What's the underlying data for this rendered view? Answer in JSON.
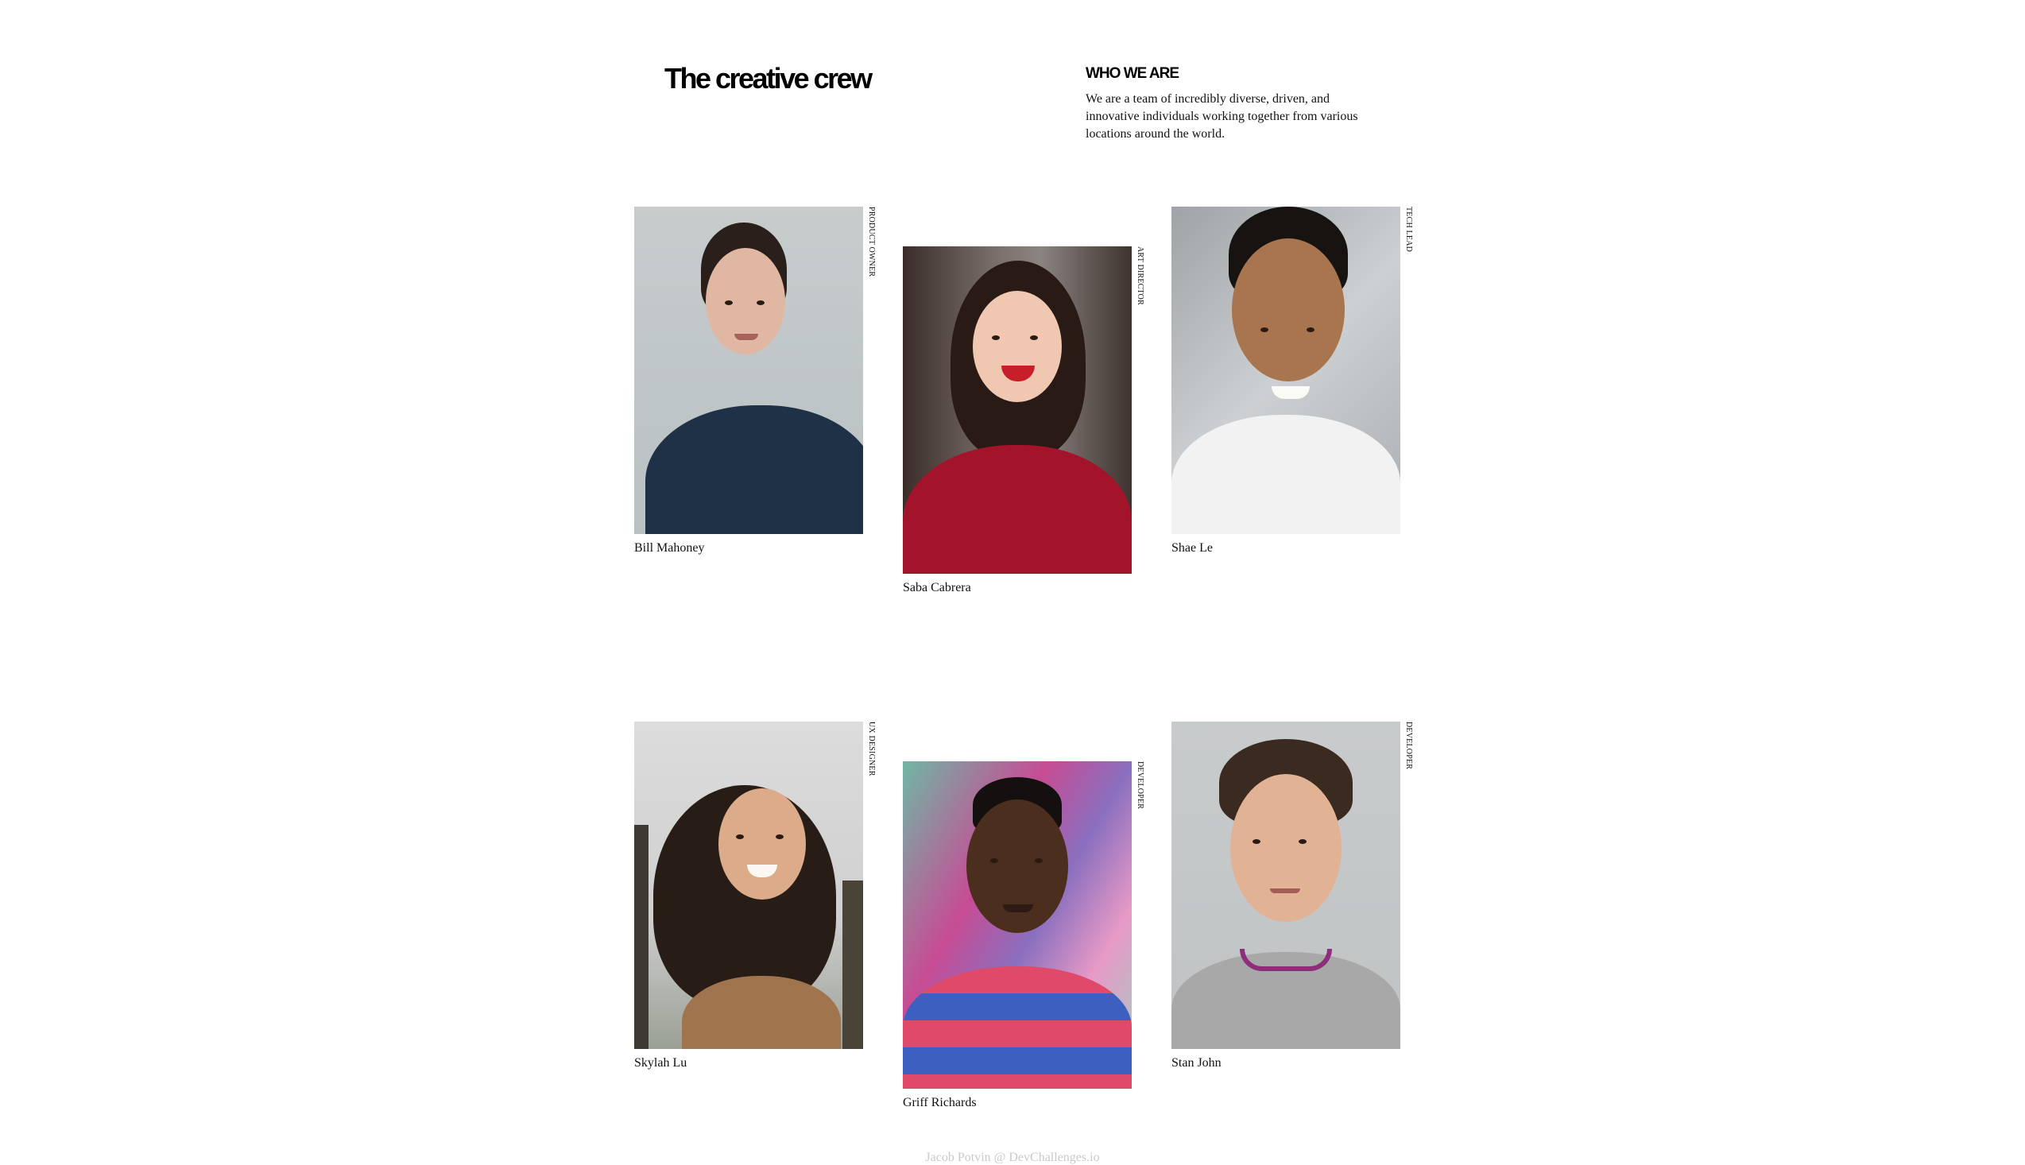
{
  "header": {
    "title": "The creative crew",
    "who_heading": "WHO WE ARE",
    "who_text": "We are a team of incredibly diverse, driven, and innovative individuals working together from various locations around the world."
  },
  "members": [
    {
      "name": "Bill Mahoney",
      "role": "PRODUCT OWNER"
    },
    {
      "name": "Saba Cabrera",
      "role": "ART DIRECTOR"
    },
    {
      "name": "Shae Le",
      "role": "TECH LEAD"
    },
    {
      "name": "Skylah Lu",
      "role": "UX DESIGNER"
    },
    {
      "name": "Griff Richards",
      "role": "DEVELOPER"
    },
    {
      "name": "Stan John",
      "role": "DEVELOPER"
    }
  ],
  "footer": {
    "credit": "Jacob Potvin @ DevChallenges.io"
  },
  "colors": {
    "text": "#111111",
    "footer": "#c9c9c9",
    "background": "#ffffff"
  }
}
